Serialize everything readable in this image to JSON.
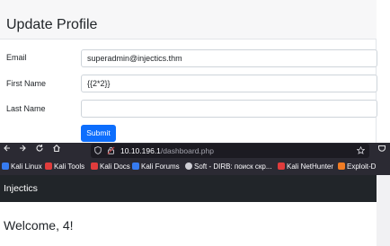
{
  "profile": {
    "title": "Update Profile",
    "email_label": "Email",
    "email_value": "superadmin@injectics.thm",
    "first_name_label": "First Name",
    "first_name_value": "{{2*2}}",
    "last_name_label": "Last Name",
    "last_name_value": "",
    "submit_label": "Submit"
  },
  "browser": {
    "back_icon": "back-arrow-icon",
    "forward_icon": "forward-arrow-icon",
    "reload_icon": "reload-icon",
    "home_icon": "home-icon",
    "url_host": "10.10.196.1",
    "url_path": "/dashboard.php",
    "bookmarks": [
      {
        "label": "Kali Linux",
        "color": "#367bf0"
      },
      {
        "label": "Kali Tools",
        "color": "#e03c3c"
      },
      {
        "label": "Kali Docs",
        "color": "#e03c3c"
      },
      {
        "label": "Kali Forums",
        "color": "#367bf0"
      },
      {
        "label": "Soft - DIRB: поиск скр...",
        "color": "#cfcfd6"
      },
      {
        "label": "Kali NetHunter",
        "color": "#e03c3c"
      },
      {
        "label": "Exploit-D",
        "color": "#f07c24"
      }
    ]
  },
  "dashboard": {
    "brand": "Injectics",
    "welcome": "Welcome, 4!"
  }
}
